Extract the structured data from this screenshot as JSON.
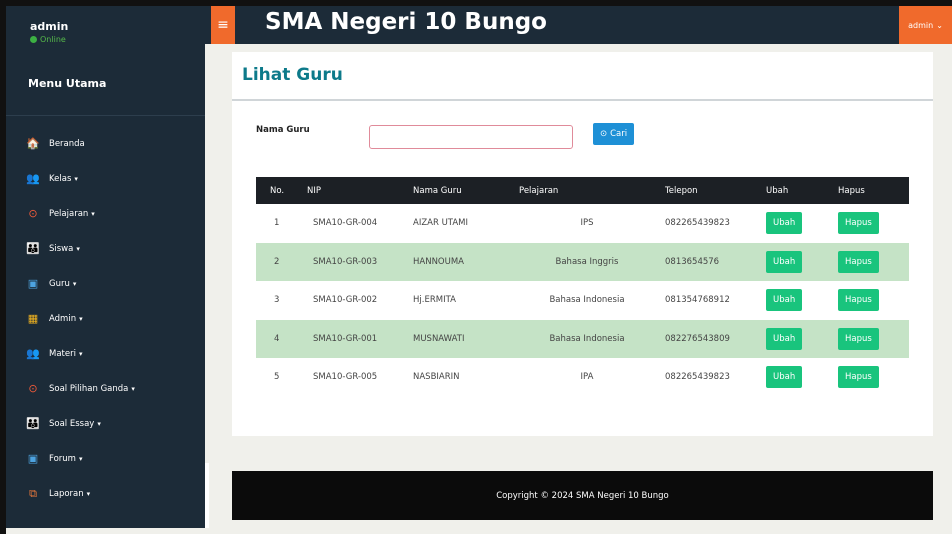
{
  "user": {
    "name": "admin",
    "status": "Online"
  },
  "sidebar": {
    "title": "Menu Utama",
    "items": [
      {
        "label": "Beranda",
        "caret": "",
        "icon": "home-icon",
        "glyph": "🏠",
        "color": "#ffffff"
      },
      {
        "label": "Kelas",
        "caret": "▾",
        "icon": "users-icon",
        "glyph": "👥",
        "color": "#f3b51f"
      },
      {
        "label": "Pelajaran",
        "caret": "▾",
        "icon": "clock-icon",
        "glyph": "⊙",
        "color": "#f05a3a"
      },
      {
        "label": "Siswa",
        "caret": "▾",
        "icon": "group-icon",
        "glyph": "👪",
        "color": "#f07a3a"
      },
      {
        "label": "Guru",
        "caret": "▾",
        "icon": "id-card-icon",
        "glyph": "▣",
        "color": "#4da3e0"
      },
      {
        "label": "Admin",
        "caret": "▾",
        "icon": "table-icon",
        "glyph": "▦",
        "color": "#f3b51f"
      },
      {
        "label": "Materi",
        "caret": "▾",
        "icon": "users-icon",
        "glyph": "👥",
        "color": "#f3b51f"
      },
      {
        "label": "Soal Pilihan Ganda",
        "caret": "▾",
        "icon": "clock-icon",
        "glyph": "⊙",
        "color": "#f05a3a"
      },
      {
        "label": "Soal Essay",
        "caret": "▾",
        "icon": "group-icon",
        "glyph": "👪",
        "color": "#f07a3a"
      },
      {
        "label": "Forum",
        "caret": "▾",
        "icon": "id-card-icon",
        "glyph": "▣",
        "color": "#4da3e0"
      },
      {
        "label": "Laporan",
        "caret": "▾",
        "icon": "copy-icon",
        "glyph": "⧉",
        "color": "#f07a3a"
      }
    ]
  },
  "topbar": {
    "menu_glyph": "≡",
    "title": "SMA Negeri 10 Bungo",
    "user_label": "admin",
    "user_caret": "⌄"
  },
  "page": {
    "title": "Lihat Guru"
  },
  "search": {
    "label": "Nama Guru",
    "value": "",
    "button": "Cari",
    "button_icon": "⊙"
  },
  "table": {
    "headers": {
      "no": "No.",
      "nip": "NIP",
      "nama": "Nama Guru",
      "pelajaran": "Pelajaran",
      "telepon": "Telepon",
      "ubah": "Ubah",
      "hapus": "Hapus"
    },
    "rows": [
      {
        "no": "1",
        "nip": "SMA10-GR-004",
        "nama": "AIZAR UTAMI",
        "pelajaran": "IPS",
        "telepon": "082265439823"
      },
      {
        "no": "2",
        "nip": "SMA10-GR-003",
        "nama": "HANNOUMA",
        "pelajaran": "Bahasa Inggris",
        "telepon": "0813654576"
      },
      {
        "no": "3",
        "nip": "SMA10-GR-002",
        "nama": "Hj.ERMITA",
        "pelajaran": "Bahasa Indonesia",
        "telepon": "081354768912"
      },
      {
        "no": "4",
        "nip": "SMA10-GR-001",
        "nama": "MUSNAWATI",
        "pelajaran": "Bahasa Indonesia",
        "telepon": "082276543809"
      },
      {
        "no": "5",
        "nip": "SMA10-GR-005",
        "nama": "NASBIARIN",
        "pelajaran": "IPA",
        "telepon": "082265439823"
      }
    ],
    "ubah_label": "Ubah",
    "hapus_label": "Hapus"
  },
  "footer": {
    "text": "Copyright © 2024 SMA Negeri 10 Bungo"
  },
  "colors": {
    "sidebar": "#1c2b38",
    "accent": "#f06a2c",
    "title": "#0d7a8a",
    "action": "#19c47d",
    "alt_row": "#c5e3c6"
  }
}
